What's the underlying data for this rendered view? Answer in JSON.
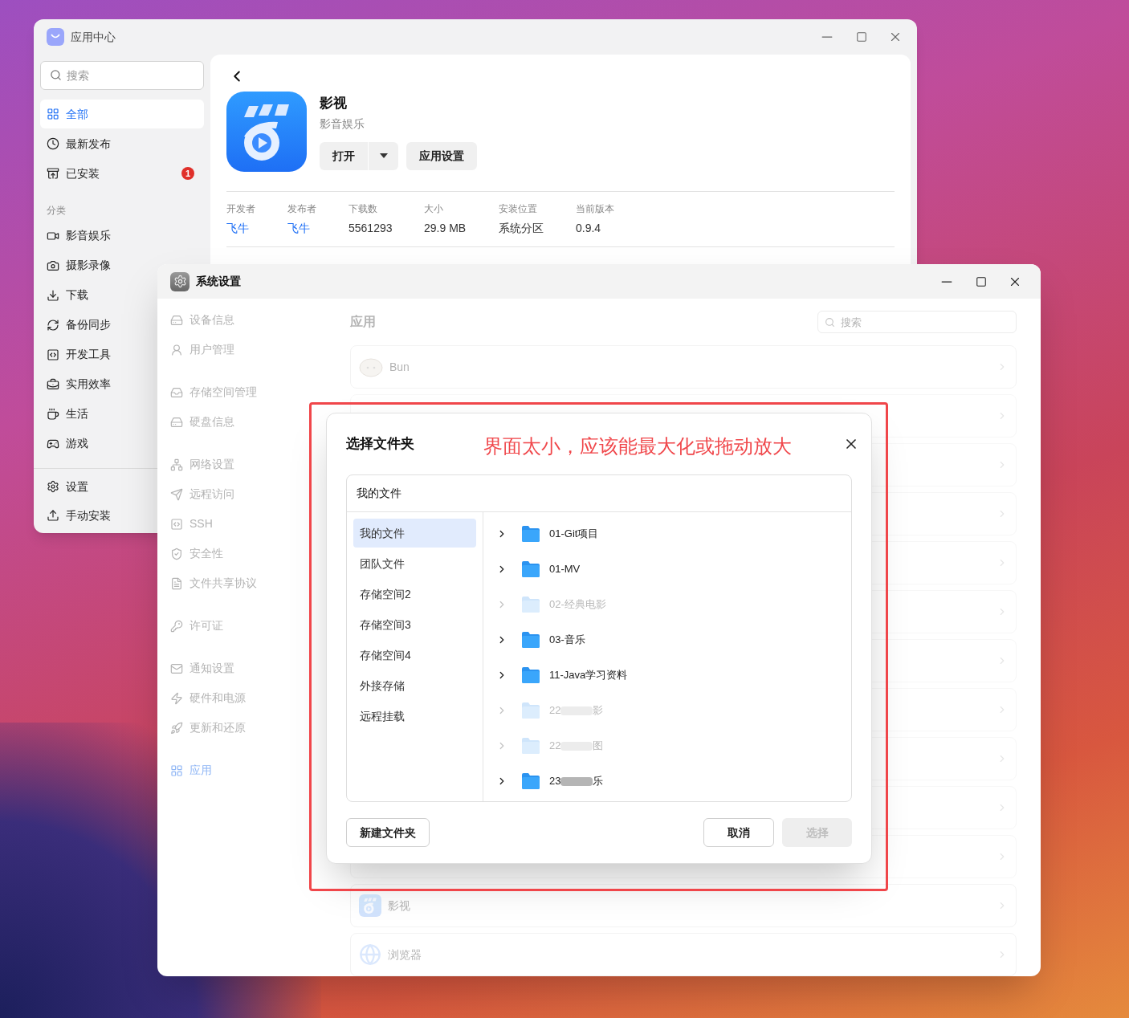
{
  "annotation": {
    "text": "界面太小，应该能最大化或拖动放大"
  },
  "app_center": {
    "title": "应用中心",
    "search": {
      "placeholder": "搜索"
    },
    "nav": [
      {
        "label": "全部",
        "selected": true
      },
      {
        "label": "最新发布",
        "selected": false
      },
      {
        "label": "已安装",
        "selected": false,
        "badge": "1"
      }
    ],
    "category_heading": "分类",
    "categories": [
      {
        "label": "影音娱乐",
        "selected": false
      },
      {
        "label": "摄影录像",
        "selected": false
      },
      {
        "label": "下载",
        "selected": false
      },
      {
        "label": "备份同步",
        "selected": false
      },
      {
        "label": "开发工具",
        "selected": false
      },
      {
        "label": "实用效率",
        "selected": false
      },
      {
        "label": "生活",
        "selected": false
      },
      {
        "label": "游戏",
        "selected": false
      }
    ],
    "footer": [
      {
        "label": "设置"
      },
      {
        "label": "手动安装"
      }
    ],
    "app": {
      "name": "影视",
      "category": "影音娱乐",
      "open_button": "打开",
      "settings_button": "应用设置",
      "info": [
        {
          "label": "开发者",
          "value": "飞牛",
          "link": true
        },
        {
          "label": "发布者",
          "value": "飞牛",
          "link": true
        },
        {
          "label": "下载数",
          "value": "5561293",
          "link": false
        },
        {
          "label": "大小",
          "value": "29.9 MB",
          "link": false
        },
        {
          "label": "安装位置",
          "value": "系统分区",
          "link": false
        },
        {
          "label": "当前版本",
          "value": "0.9.4",
          "link": false
        }
      ]
    }
  },
  "system_settings": {
    "title": "系统设置",
    "nav_groups": [
      {
        "items": [
          {
            "label": "设备信息",
            "selected": false
          },
          {
            "label": "用户管理",
            "selected": false
          }
        ]
      },
      {
        "items": [
          {
            "label": "存储空间管理",
            "selected": false
          },
          {
            "label": "硬盘信息",
            "selected": false
          }
        ]
      },
      {
        "items": [
          {
            "label": "网络设置",
            "selected": false
          },
          {
            "label": "远程访问",
            "selected": false
          },
          {
            "label": "SSH",
            "selected": false
          },
          {
            "label": "安全性",
            "selected": false
          },
          {
            "label": "文件共享协议",
            "selected": false
          }
        ]
      },
      {
        "items": [
          {
            "label": "许可证",
            "selected": false
          }
        ]
      },
      {
        "items": [
          {
            "label": "通知设置",
            "selected": false
          },
          {
            "label": "硬件和电源",
            "selected": false
          },
          {
            "label": "更新和还原",
            "selected": false
          }
        ]
      },
      {
        "items": [
          {
            "label": "应用",
            "selected": true
          }
        ]
      }
    ],
    "page_title": "应用",
    "search": {
      "placeholder": "搜索"
    },
    "rows": [
      {
        "kind": "bun",
        "label": "Bun"
      },
      {
        "kind": "covered"
      },
      {
        "kind": "covered"
      },
      {
        "kind": "covered"
      },
      {
        "kind": "covered"
      },
      {
        "kind": "covered"
      },
      {
        "kind": "covered"
      },
      {
        "kind": "covered"
      },
      {
        "kind": "covered"
      },
      {
        "kind": "covered"
      },
      {
        "kind": "covered"
      },
      {
        "kind": "video",
        "label": "影视"
      },
      {
        "kind": "browser",
        "label": "浏览器"
      }
    ]
  },
  "dialog": {
    "title": "选择文件夹",
    "root": "我的文件",
    "locations": [
      {
        "label": "我的文件",
        "selected": true
      },
      {
        "label": "团队文件",
        "selected": false
      },
      {
        "label": "存储空间2",
        "selected": false
      },
      {
        "label": "存储空间3",
        "selected": false
      },
      {
        "label": "存储空间4",
        "selected": false
      },
      {
        "label": "外接存储",
        "selected": false
      },
      {
        "label": "远程挂载",
        "selected": false
      }
    ],
    "folders": [
      {
        "name": "01-Git项目",
        "disabled": false
      },
      {
        "name": "01-MV",
        "disabled": false
      },
      {
        "name": "02-经典电影",
        "disabled": true
      },
      {
        "name": "03-音乐",
        "disabled": false
      },
      {
        "name": "11-Java学习资料",
        "disabled": false
      },
      {
        "name": "22",
        "name_end": "影",
        "disabled": true
      },
      {
        "name": "22",
        "name_end": "图",
        "disabled": true
      },
      {
        "name": "23",
        "name_end": "乐",
        "disabled": false
      }
    ],
    "new_folder_button": "新建文件夹",
    "cancel_button": "取消",
    "confirm_button": {
      "label": "选择",
      "disabled": true
    }
  }
}
